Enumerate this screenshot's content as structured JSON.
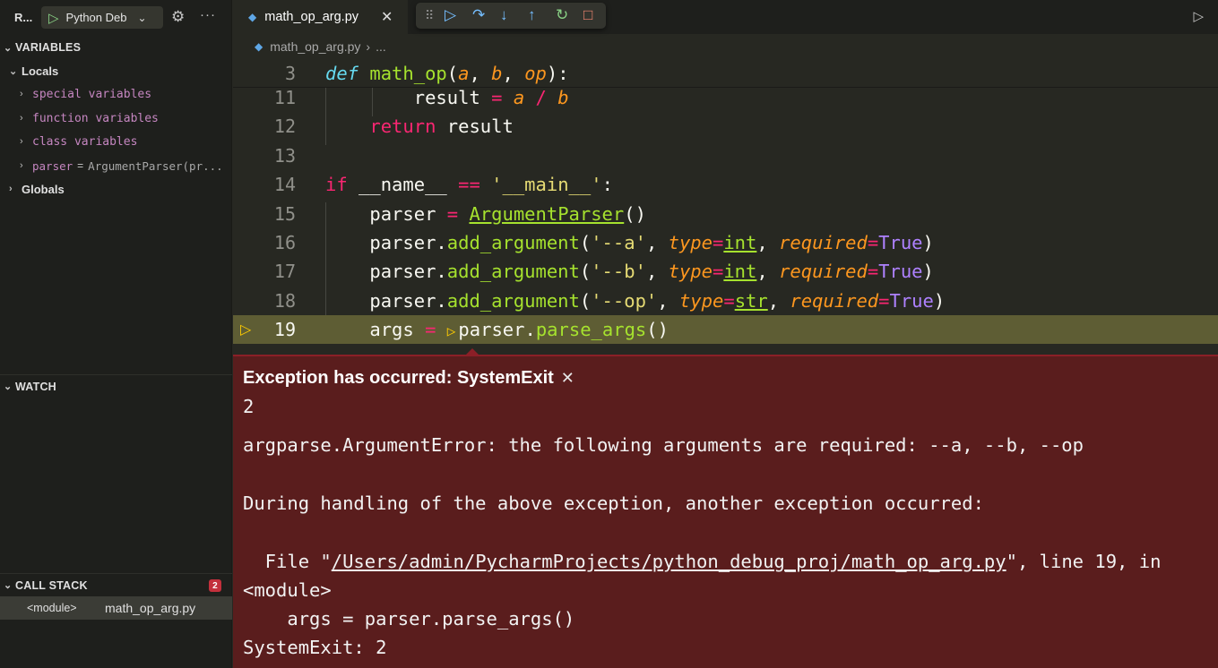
{
  "sidebar": {
    "run_label": "R...",
    "config_name": "Python Deb",
    "variables_header": "VARIABLES",
    "locals_label": "Locals",
    "locals": [
      {
        "name": "special variables"
      },
      {
        "name": "function variables"
      },
      {
        "name": "class variables"
      },
      {
        "name": "parser",
        "value": "ArgumentParser(pr..."
      }
    ],
    "globals_label": "Globals",
    "watch_header": "WATCH",
    "callstack_header": "CALL STACK",
    "callstack_count": "2",
    "callstack_frame": "<module>",
    "callstack_file": "math_op_arg.py"
  },
  "editor": {
    "tab_name": "math_op_arg.py",
    "breadcrumb_file": "math_op_arg.py",
    "breadcrumb_sep": "›",
    "breadcrumb_more": "...",
    "lines": {
      "3": "3",
      "11": "11",
      "12": "12",
      "13": "13",
      "14": "14",
      "15": "15",
      "16": "16",
      "17": "17",
      "18": "18",
      "19": "19"
    }
  },
  "exception": {
    "title": "Exception has occurred: SystemExit",
    "code": "2",
    "error": "argparse.ArgumentError: the following arguments are required: --a, --b, --op",
    "during": "During handling of the above exception, another exception occurred:",
    "file_prefix": "  File \"",
    "file_path": "/Users/admin/PycharmProjects/python_debug_proj/math_op_arg.py",
    "file_suffix": "\", line 19, in",
    "module": "<module>",
    "statement": "    args = parser.parse_args()",
    "final": "SystemExit: 2"
  },
  "colors": {
    "editor_bg": "#272822",
    "exception_bg": "#5a1d1d",
    "current_line": "#5e5d34",
    "keyword": "#f92672",
    "function": "#a6e22e",
    "string": "#e6db74"
  }
}
